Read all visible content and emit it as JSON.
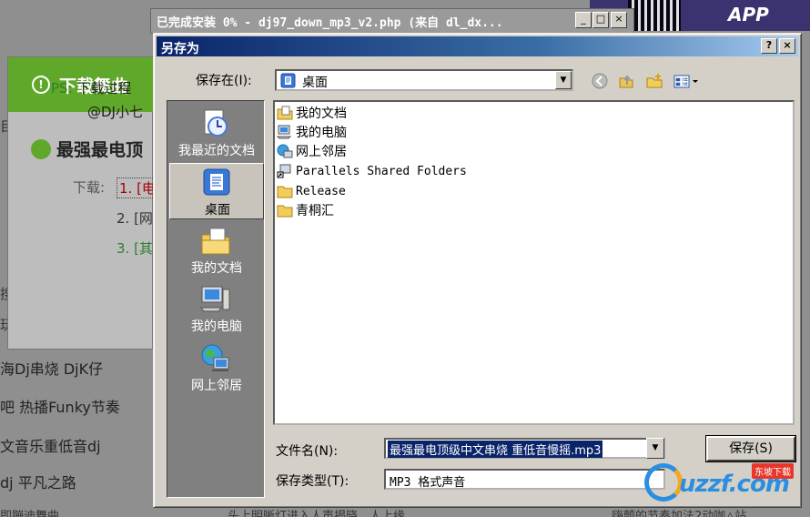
{
  "background": {
    "panel_title": "下载舞曲",
    "ps_tag": "PS:",
    "ps_text": "下载过程",
    "author": "@DJ小七",
    "song_title": "最强最电顶",
    "download_label": "下载:",
    "links": [
      "1. [电",
      "2. [网",
      "3. [其"
    ],
    "left_list": [
      "海Dj串烧 DjK仔",
      "吧 热播Funky节奏",
      "文音乐重低音dj",
      "dj 平凡之路"
    ],
    "side_chars": [
      "目",
      "搜",
      "玩"
    ],
    "ad_text": "APP",
    "bottom_left": "即蹦迪舞曲",
    "bottom_mid": "头上明晰灯进入人声揭晓，人上缘",
    "bottom_right": "嗨颤的节奏加法2动咖△站"
  },
  "progress_window": {
    "title": "已完成安装 0% - dj97_down_mp3_v2.php (来自 dl_dx...",
    "minimize": "_",
    "maximize": "□",
    "close": "×"
  },
  "dialog": {
    "title": "另存为",
    "help_btn": "?",
    "close_btn": "×",
    "save_in_label": "保存在(I):",
    "save_in_value": "桌面",
    "places": [
      "我最近的文档",
      "桌面",
      "我的文档",
      "我的电脑",
      "网上邻居"
    ],
    "files": [
      {
        "name": "我的文档",
        "icon": "my-documents-icon"
      },
      {
        "name": "我的电脑",
        "icon": "my-computer-icon"
      },
      {
        "name": "网上邻居",
        "icon": "network-icon"
      },
      {
        "name": "Parallels Shared Folders",
        "icon": "shortcut-icon"
      },
      {
        "name": "Release",
        "icon": "folder-icon"
      },
      {
        "name": "青桐汇",
        "icon": "folder-icon"
      }
    ],
    "filename_label": "文件名(N):",
    "filename_value": "最强最电顶级中文串烧 重低音慢摇.mp3",
    "filetype_label": "保存类型(T):",
    "filetype_value": "MP3 格式声音",
    "save_button": "保存(S)"
  },
  "watermark": {
    "logo": "uzzf.com",
    "badge": "东坡下载"
  },
  "colors": {
    "title_bar": "#0a246a",
    "panel_green": "#5fa82a",
    "dialog_face": "#d4d0c8"
  }
}
